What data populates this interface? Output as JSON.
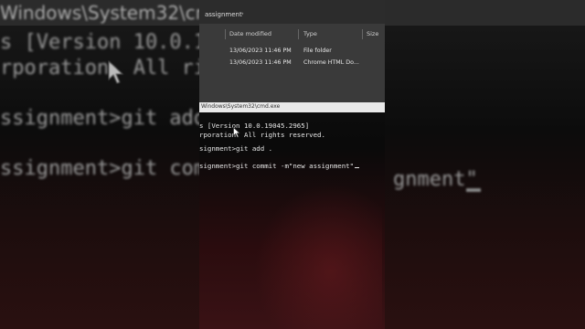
{
  "background": {
    "title_fragment": "Windows\\System32\\cmd.ex",
    "lines": [
      "s [Version 10.0.1",
      "rporation. All ri",
      "ssignment>git add",
      "ssignment>git comm",
      "gnment\""
    ]
  },
  "explorer": {
    "breadcrumb": "assignment",
    "columns": {
      "date": "Date modified",
      "type": "Type",
      "size": "Size"
    },
    "rows": [
      {
        "date": "13/06/2023 11:46 PM",
        "type": "File folder"
      },
      {
        "date": "13/06/2023 11:46 PM",
        "type": "Chrome HTML Do..."
      }
    ]
  },
  "cmd": {
    "title": "Windows\\System32\\cmd.exe",
    "lines": [
      "s [Version 10.0.19045.2965]",
      "rporation. All rights reserved.",
      "signment>git add .",
      "signment>git commit -m\"new assignment\""
    ]
  },
  "colors": {
    "terminal_text": "#e6e6e6",
    "explorer_bg": "#3a3a3a",
    "terminal_bg": "#0c0c0c"
  }
}
